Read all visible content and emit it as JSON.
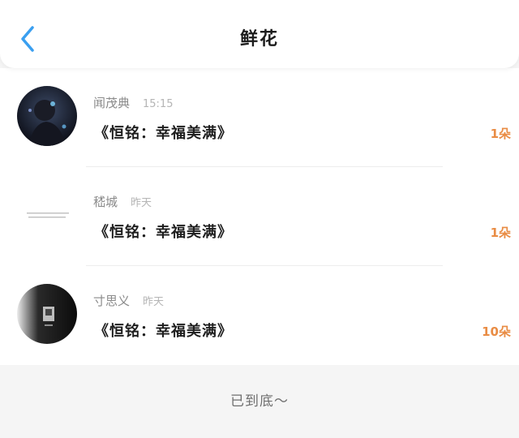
{
  "header": {
    "title": "鲜花",
    "back_icon": "chevron-left-icon",
    "accent": "#3a9ff0"
  },
  "records": [
    {
      "name": "闻茂典",
      "time": "15:15",
      "gift": "《恒铭：幸福美满》",
      "count": "1朵"
    },
    {
      "name": "嵇城",
      "time": "昨天",
      "gift": "《恒铭：幸福美满》",
      "count": "1朵"
    },
    {
      "name": "寸思义",
      "time": "昨天",
      "gift": "《恒铭：幸福美满》",
      "count": "10朵"
    }
  ],
  "footer": {
    "text": "已到底～"
  },
  "colors": {
    "count": "#e98c44",
    "background": "#f5f5f5"
  }
}
